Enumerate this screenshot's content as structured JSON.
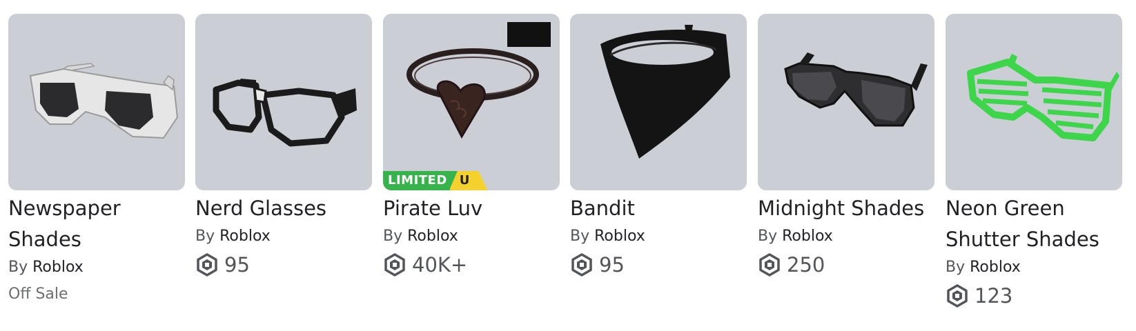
{
  "items": [
    {
      "name": "Newspaper Shades",
      "by_label": "By",
      "creator": "Roblox",
      "status": "Off Sale",
      "price": null,
      "icon": "newspaper-shades-thumbnail"
    },
    {
      "name": "Nerd Glasses",
      "by_label": "By",
      "creator": "Roblox",
      "status": null,
      "price": "95",
      "icon": "nerd-glasses-thumbnail"
    },
    {
      "name": "Pirate Luv",
      "by_label": "By",
      "creator": "Roblox",
      "status": null,
      "price": "40K+",
      "badge": {
        "label": "LIMITED",
        "u": "U"
      },
      "icon": "pirate-luv-thumbnail"
    },
    {
      "name": "Bandit",
      "by_label": "By",
      "creator": "Roblox",
      "status": null,
      "price": "95",
      "icon": "bandit-thumbnail"
    },
    {
      "name": "Midnight Shades",
      "by_label": "By",
      "creator": "Roblox",
      "status": null,
      "price": "250",
      "icon": "midnight-shades-thumbnail"
    },
    {
      "name": "Neon Green Shutter Shades",
      "by_label": "By",
      "creator": "Roblox",
      "status": null,
      "price": "123",
      "icon": "neon-green-shutter-shades-thumbnail"
    }
  ],
  "colors": {
    "thumb_bg": "#ccced6",
    "limited_green": "#36b44b",
    "limited_yellow": "#f5d12e",
    "text_primary": "#1f2125",
    "text_secondary": "#52555a"
  }
}
